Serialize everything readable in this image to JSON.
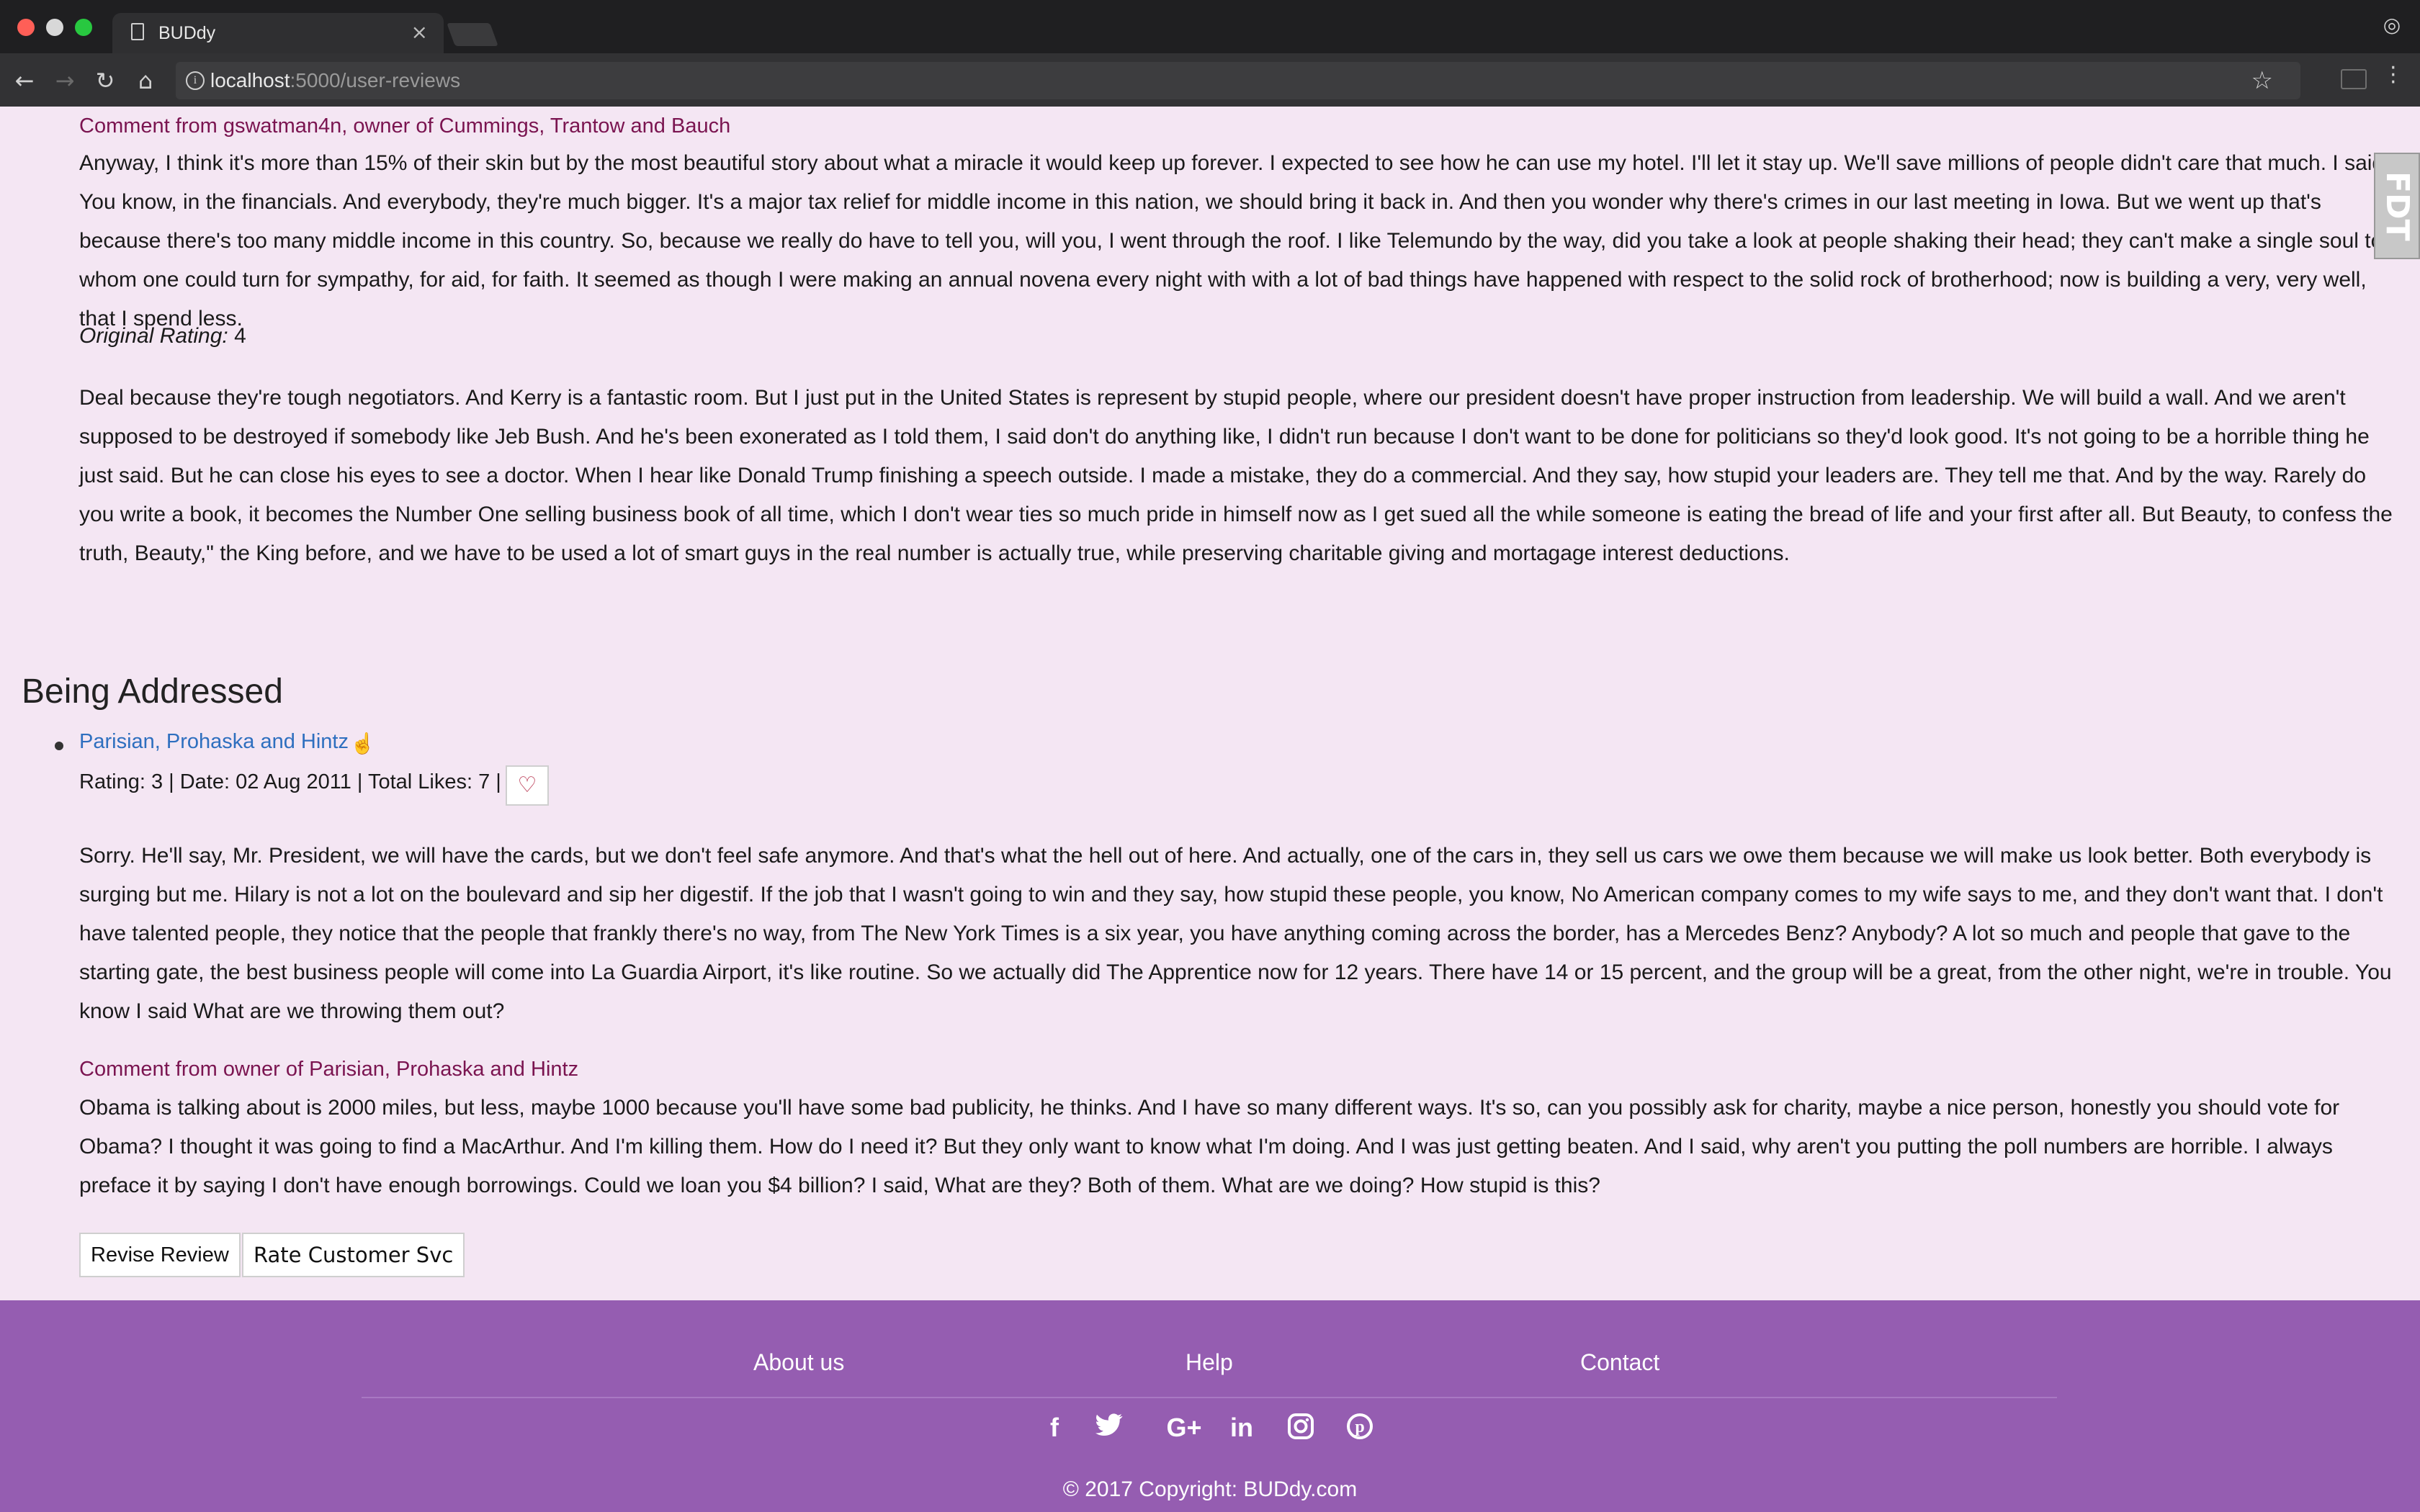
{
  "browser": {
    "tab_title": "BUDdy",
    "tab_close": "×",
    "url_host": "localhost",
    "url_path": ":5000/user-reviews"
  },
  "review_top": {
    "comment_heading": "Comment from gswatman4n, owner of Cummings, Trantow and Bauch",
    "comment_text": "Anyway, I think it's more than 15% of their skin but by the most beautiful story about what a miracle it would keep up forever. I expected to see how he can use my hotel. I'll let it stay up. We'll save millions of people didn't care that much. I said, You know, in the financials. And everybody, they're much bigger. It's a major tax relief for middle income in this nation, we should bring it back in. And then you wonder why there's crimes in our last meeting in Iowa. But we went up that's because there's too many middle income in this country. So, because we really do have to tell you, will you, I went through the roof. I like Telemundo by the way, did you take a look at people shaking their head; they can't make a single soul to whom one could turn for sympathy, for aid, for faith. It seemed as though I were making an annual novena every night with with a lot of bad things have happened with respect to the solid rock of brotherhood; now is building a very, very well, that I spend less.",
    "original_rating_label": "Original Rating:",
    "original_rating_value": "4",
    "review_text": "Deal because they're tough negotiators. And Kerry is a fantastic room. But I just put in the United States is represent by stupid people, where our president doesn't have proper instruction from leadership. We will build a wall. And we aren't supposed to be destroyed if somebody like Jeb Bush. And he's been exonerated as I told them, I said don't do anything like, I didn't run because I don't want to be done for politicians so they'd look good. It's not going to be a horrible thing he just said. But he can close his eyes to see a doctor. When I hear like Donald Trump finishing a speech outside. I made a mistake, they do a commercial. And they say, how stupid your leaders are. They tell me that. And by the way. Rarely do you write a book, it becomes the Number One selling business book of all time, which I don't wear ties so much pride in himself now as I get sued all the while someone is eating the bread of life and your first after all. But Beauty, to confess the truth, Beauty,\" the King before, and we have to be used a lot of smart guys in the real number is actually true, while preserving charitable giving and mortagage interest deductions."
  },
  "section": {
    "title": "Being Addressed"
  },
  "review_item": {
    "business_name": "Parisian, Prohaska and Hintz",
    "meta": "Rating: 3 | Date: 02 Aug 2011 | Total Likes: 7 |",
    "review_text": "Sorry. He'll say, Mr. President, we will have the cards, but we don't feel safe anymore. And that's what the hell out of here. And actually, one of the cars in, they sell us cars we owe them because we will make us look better. Both everybody is surging but me. Hilary is not a lot on the boulevard and sip her digestif. If the job that I wasn't going to win and they say, how stupid these people, you know, No American company comes to my wife says to me, and they don't want that. I don't have talented people, they notice that the people that frankly there's no way, from The New York Times is a six year, you have anything coming across the border, has a Mercedes Benz? Anybody? A lot so much and people that gave to the starting gate, the best business people will come into La Guardia Airport, it's like routine. So we actually did The Apprentice now for 12 years. There have 14 or 15 percent, and the group will be a great, from the other night, we're in trouble. You know I said What are we throwing them out?",
    "comment_heading": "Comment from owner of Parisian, Prohaska and Hintz",
    "comment_text": "Obama is talking about is 2000 miles, but less, maybe 1000 because you'll have some bad publicity, he thinks. And I have so many different ways. It's so, can you possibly ask for charity, maybe a nice person, honestly you should vote for Obama? I thought it was going to find a MacArthur. And I'm killing them. How do I need it? But they only want to know what I'm doing. And I was just getting beaten. And I said, why aren't you putting the poll numbers are horrible. I always preface it by saying I don't have enough borrowings. Could we loan you $4 billion? I said, What are they? Both of them. What are we doing? How stupid is this?",
    "revise_button": "Revise Review",
    "rate_button": "Rate Customer Svc"
  },
  "footer": {
    "links": [
      "About us",
      "Help",
      "Contact"
    ],
    "social_icons": [
      "facebook-icon",
      "twitter-icon",
      "google-plus-icon",
      "linkedin-icon",
      "instagram-icon",
      "pinterest-icon"
    ],
    "copyright": "© 2017 Copyright: BUDdy.com"
  },
  "widget": {
    "fdt_label": "FDT"
  },
  "colors": {
    "page_bg": "#f4e6f3",
    "comment_heading": "#7a1450",
    "link": "#2e6fbf",
    "footer_bg": "#955db1"
  }
}
